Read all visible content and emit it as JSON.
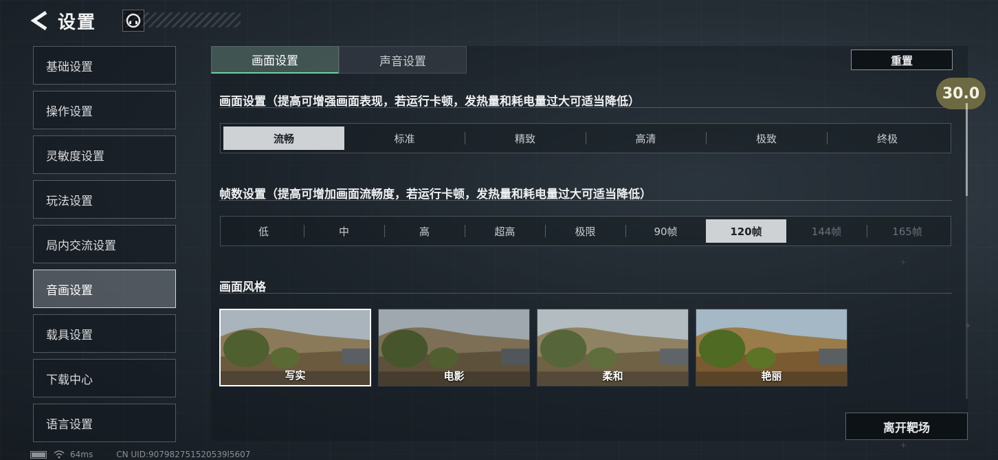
{
  "header": {
    "title": "设置"
  },
  "sidebar": {
    "items": [
      {
        "label": "基础设置"
      },
      {
        "label": "操作设置"
      },
      {
        "label": "灵敏度设置"
      },
      {
        "label": "玩法设置"
      },
      {
        "label": "局内交流设置"
      },
      {
        "label": "音画设置",
        "active": true
      },
      {
        "label": "载具设置"
      },
      {
        "label": "下载中心"
      },
      {
        "label": "语言设置"
      }
    ]
  },
  "tabs": [
    {
      "label": "画面设置",
      "active": true
    },
    {
      "label": "声音设置"
    }
  ],
  "reset_label": "重置",
  "quality": {
    "title": "画面设置（提高可增强画面表现，若运行卡顿，发热量和耗电量过大可适当降低）",
    "options": [
      "流畅",
      "标准",
      "精致",
      "高清",
      "极致",
      "终极"
    ],
    "selected": "流畅"
  },
  "framerate": {
    "title": "帧数设置（提高可增加画面流畅度，若运行卡顿，发热量和耗电量过大可适当降低）",
    "options": [
      "低",
      "中",
      "高",
      "超高",
      "极限",
      "90帧",
      "120帧",
      "144帧",
      "165帧"
    ],
    "selected": "120帧",
    "disabled": [
      "144帧",
      "165帧"
    ]
  },
  "style": {
    "title": "画面风格",
    "options": [
      "写实",
      "电影",
      "柔和",
      "艳丽"
    ],
    "selected": "写实"
  },
  "fps_value": "30.0",
  "leave_label": "离开靶场",
  "status": {
    "ping": "64ms",
    "uid": "CN UID:907982751520539l5607"
  },
  "colors": {
    "accent_tab": "#6fd1a0",
    "fps_badge": "#6d6a43",
    "selected_option": "#cfd2d5"
  }
}
